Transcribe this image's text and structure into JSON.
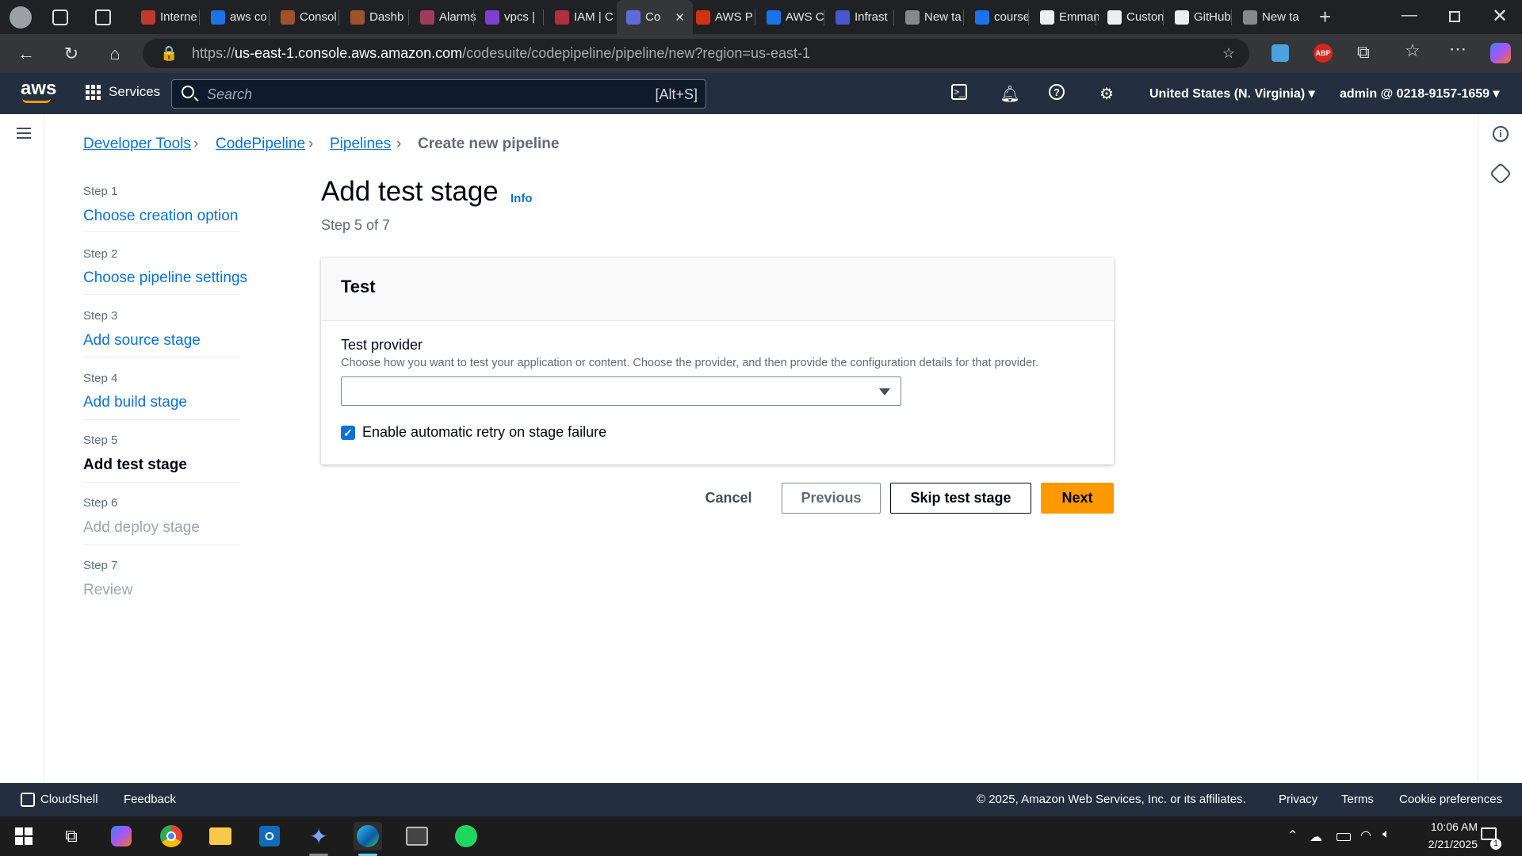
{
  "browser": {
    "tabs": [
      {
        "label": "Interne",
        "color": "#c0392b"
      },
      {
        "label": "aws co",
        "color": "#1a73e8"
      },
      {
        "label": "Consol",
        "color": "#a0522d"
      },
      {
        "label": "Dashb",
        "color": "#a0522d"
      },
      {
        "label": "Alarms",
        "color": "#a03c5a"
      },
      {
        "label": "vpcs | ",
        "color": "#7b3fd4"
      },
      {
        "label": "IAM | C",
        "color": "#b03040"
      },
      {
        "label": "Co",
        "color": "#5f6bd8"
      },
      {
        "label": "AWS P",
        "color": "#d13212"
      },
      {
        "label": "AWS C",
        "color": "#1a73e8"
      },
      {
        "label": "Infrast",
        "color": "#4a55d0"
      },
      {
        "label": "New ta",
        "color": "#888"
      },
      {
        "label": "course",
        "color": "#1a73e8"
      },
      {
        "label": "Emman",
        "color": "#eee"
      },
      {
        "label": "Custon",
        "color": "#eee"
      },
      {
        "label": "GitHub",
        "color": "#eee"
      },
      {
        "label": "New ta",
        "color": "#888"
      }
    ],
    "url_prefix": "https://",
    "url_host": "us-east-1.console.aws.amazon.com",
    "url_path": "/codesuite/codepipeline/pipeline/new?region=us-east-1"
  },
  "aws_header": {
    "logo": "aws",
    "services": "Services",
    "search_placeholder": "Search",
    "search_shortcut": "[Alt+S]",
    "region": "United States (N. Virginia)",
    "account": "admin @ 0218-9157-1659"
  },
  "breadcrumb": {
    "items": [
      "Developer Tools",
      "CodePipeline",
      "Pipelines"
    ],
    "current": "Create new pipeline"
  },
  "steps": [
    {
      "num": "Step 1",
      "label": "Choose creation option"
    },
    {
      "num": "Step 2",
      "label": "Choose pipeline settings"
    },
    {
      "num": "Step 3",
      "label": "Add source stage"
    },
    {
      "num": "Step 4",
      "label": "Add build stage"
    },
    {
      "num": "Step 5",
      "label": "Add test stage"
    },
    {
      "num": "Step 6",
      "label": "Add deploy stage"
    },
    {
      "num": "Step 7",
      "label": "Review"
    }
  ],
  "page": {
    "title": "Add test stage",
    "info": "Info",
    "subtitle": "Step 5 of 7"
  },
  "panel": {
    "header": "Test",
    "field_label": "Test provider",
    "field_description": "Choose how you want to test your application or content. Choose the provider, and then provide the configuration details for that provider.",
    "select_value": "",
    "checkbox_label": "Enable automatic retry on stage failure",
    "checkbox_checked": true
  },
  "actions": {
    "cancel": "Cancel",
    "previous": "Previous",
    "skip": "Skip test stage",
    "next": "Next"
  },
  "footer": {
    "cloudshell": "CloudShell",
    "feedback": "Feedback",
    "copyright": "© 2025, Amazon Web Services, Inc. or its affiliates.",
    "privacy": "Privacy",
    "terms": "Terms",
    "cookies": "Cookie preferences"
  },
  "taskbar": {
    "time": "10:06 AM",
    "date": "2/21/2025",
    "notification_count": "1"
  },
  "colors": {
    "link": "#0972d3",
    "primary_button": "#ff9900",
    "aws_header": "#232f3e"
  }
}
